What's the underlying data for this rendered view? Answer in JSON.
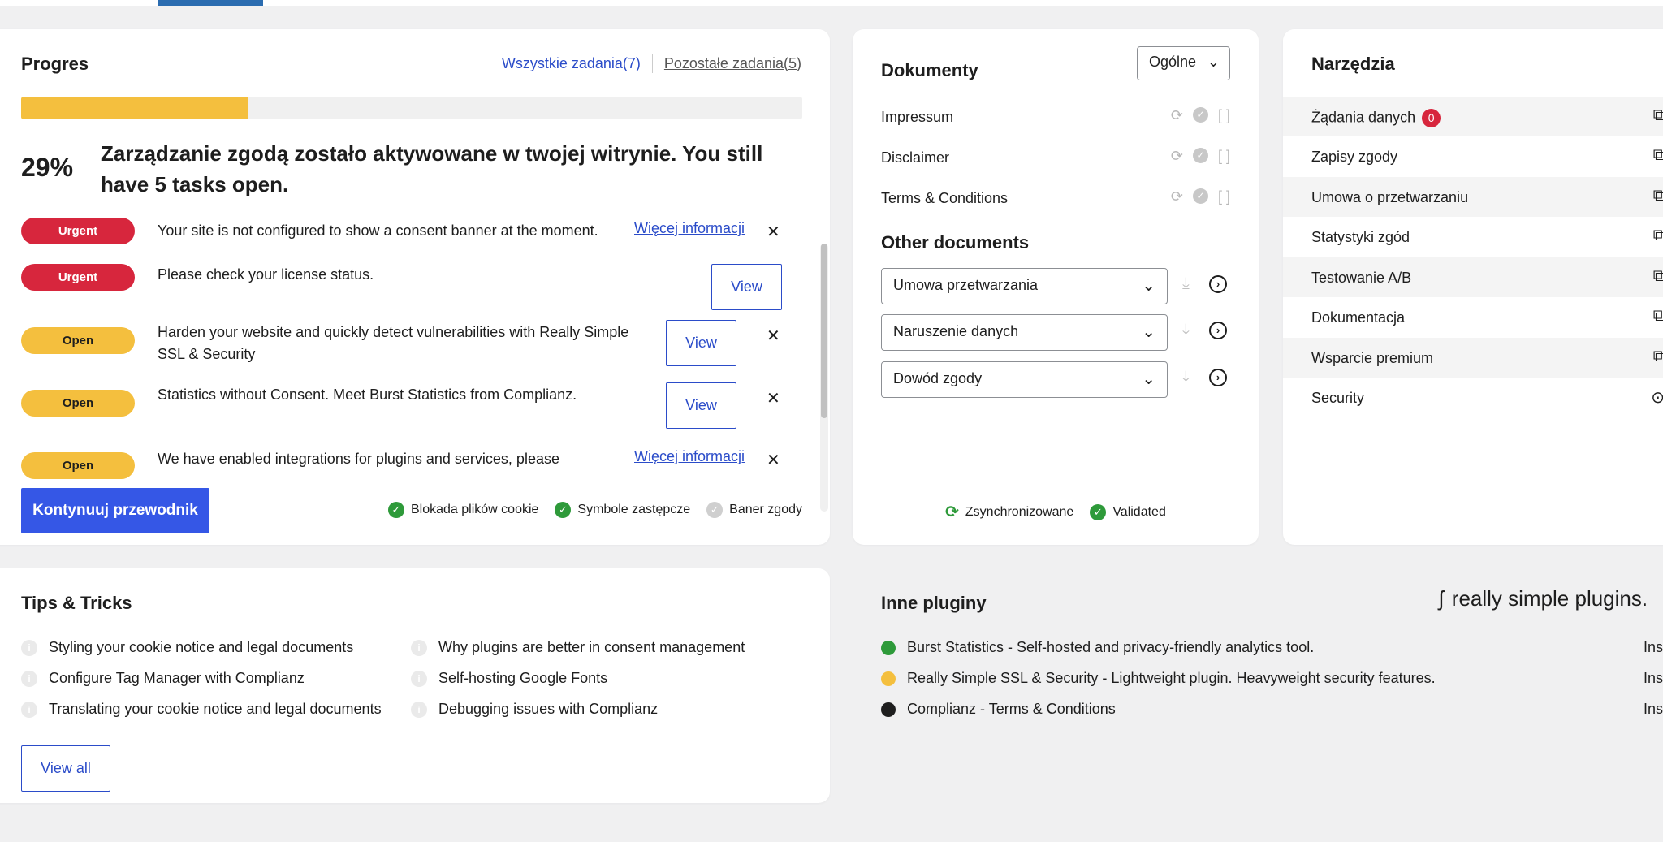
{
  "progress": {
    "title": "Progres",
    "all_tasks": "Wszystkie zadania(7)",
    "remaining_tasks": "Pozostałe zadania(5)",
    "percent": "29%",
    "percent_value": 0.29,
    "message": "Zarządzanie zgodą zostało aktywowane w twojej witrynie. You still have 5 tasks open.",
    "tasks": [
      {
        "badge": "Urgent",
        "text": "Your site is not configured to show a consent banner at the moment.",
        "link": "Więcej informacji"
      },
      {
        "badge": "Urgent",
        "text": "Please check your license status.",
        "button": "View"
      },
      {
        "badge": "Open",
        "text": "Harden your website and quickly detect vulnerabilities with Really Simple SSL & Security",
        "button": "View"
      },
      {
        "badge": "Open",
        "text": "Statistics without Consent. Meet Burst Statistics from Complianz.",
        "button": "View"
      },
      {
        "badge": "Open",
        "text": "We have enabled integrations for plugins and services, please",
        "link": "Więcej informacji"
      }
    ],
    "continue_button": "Kontynuuj przewodnik",
    "status": [
      "Blokada plików cookie",
      "Symbole zastępcze",
      "Baner zgody"
    ]
  },
  "documents": {
    "title": "Dokumenty",
    "select_value": "Ogólne",
    "items": [
      "Impressum",
      "Disclaimer",
      "Terms & Conditions"
    ],
    "other_title": "Other documents",
    "other_selects": [
      "Umowa przetwarzania",
      "Naruszenie danych",
      "Dowód zgody"
    ],
    "footer_synced": "Zsynchronizowane",
    "footer_validated": "Validated"
  },
  "tools": {
    "title": "Narzędzia",
    "items": [
      "Żądania danych",
      "Zapisy zgody",
      "Umowa o przetwarzaniu",
      "Statystyki zgód",
      "Testowanie A/B",
      "Dokumentacja",
      "Wsparcie premium",
      "Security"
    ],
    "data_requests_count": "0"
  },
  "tips": {
    "title": "Tips & Tricks",
    "items": [
      "Styling your cookie notice and legal documents",
      "Why plugins are better in consent management",
      "Configure Tag Manager with Complianz",
      "Self-hosting Google Fonts",
      "Translating your cookie notice and legal documents",
      "Debugging issues with Complianz"
    ],
    "view_all": "View all"
  },
  "plugins": {
    "title": "Inne pluginy",
    "brand": "really simple plugins.",
    "items": [
      {
        "text": "Burst Statistics - Self-hosted and privacy-friendly analytics tool.",
        "action": "Instaluj",
        "color": "#2e9a3a"
      },
      {
        "text": "Really Simple SSL & Security - Lightweight plugin. Heavyweight security features.",
        "action": "Instaluj",
        "color": "#f4bf3e"
      },
      {
        "text": "Complianz - Terms & Conditions",
        "action": "Instaluj",
        "color": "#1e1e1e"
      }
    ]
  }
}
